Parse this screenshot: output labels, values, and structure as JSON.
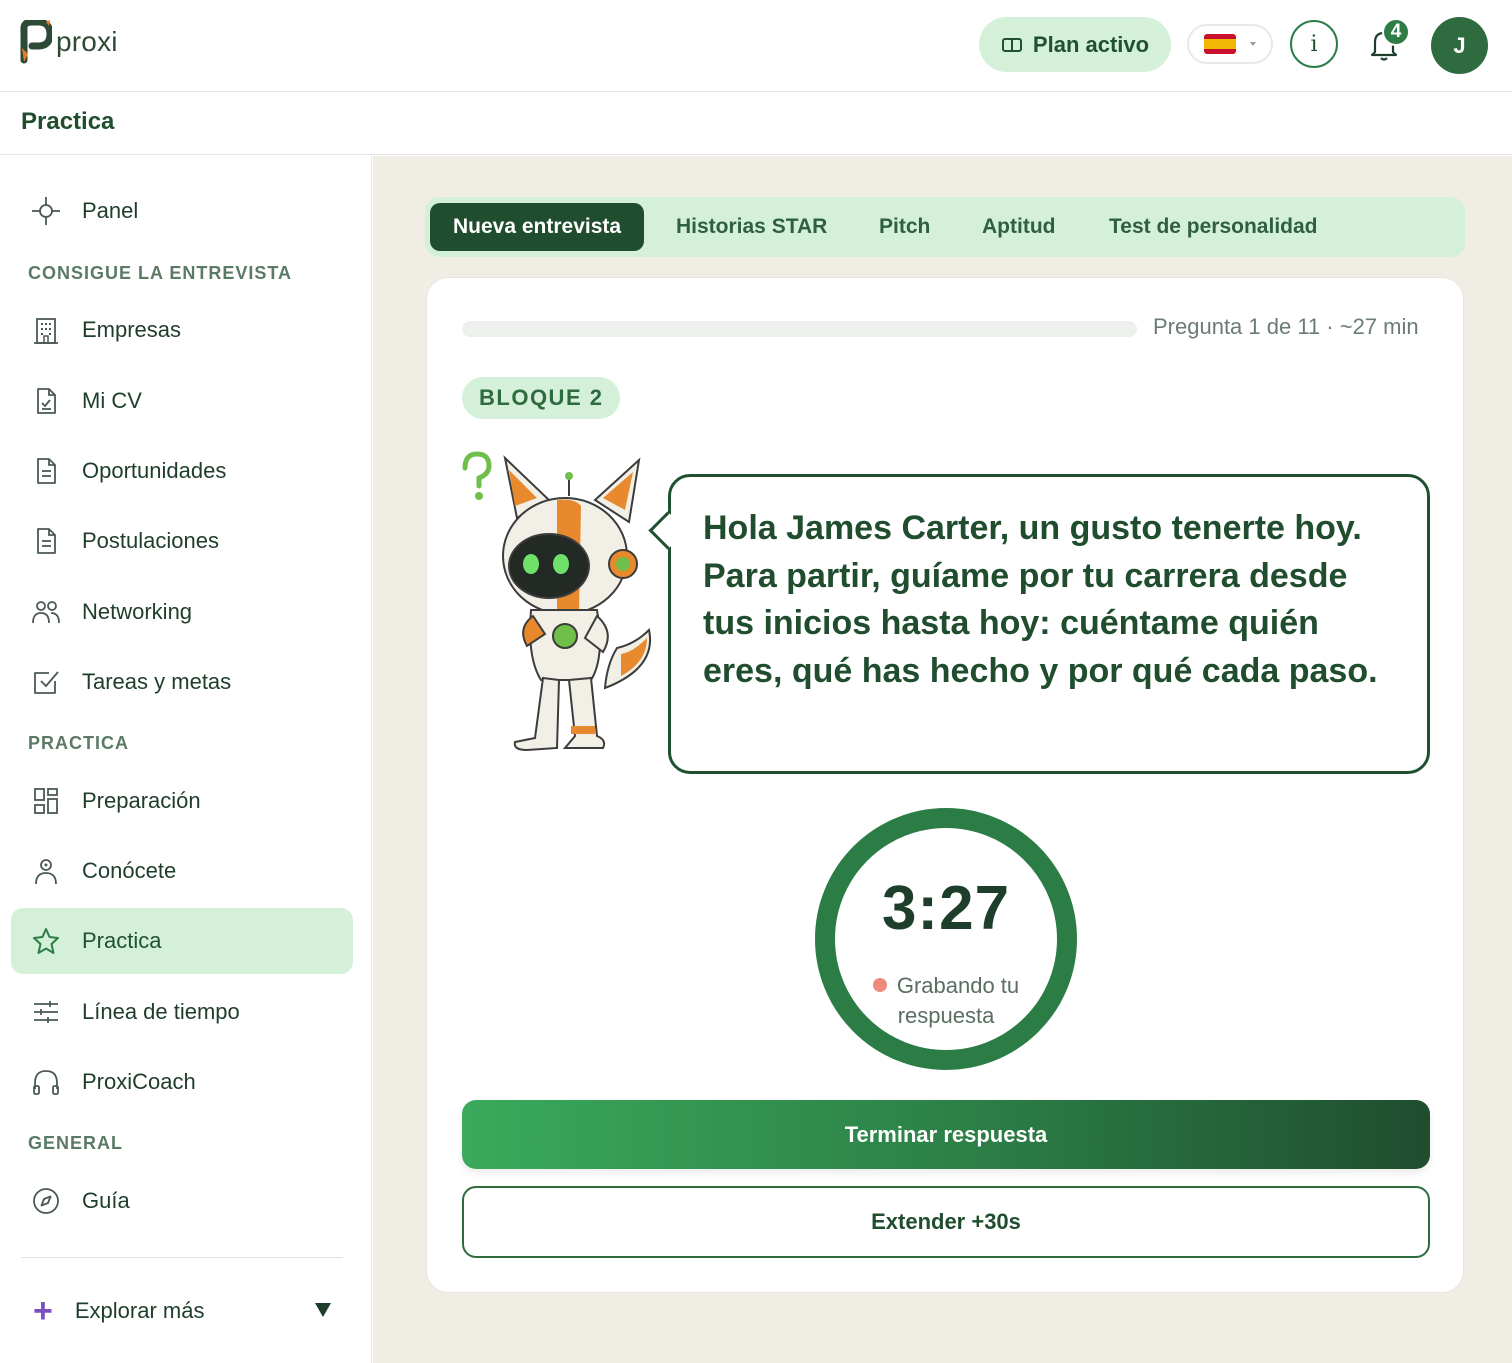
{
  "app": {
    "name": "proxi"
  },
  "header": {
    "plan_label": "Plan activo",
    "notification_count": "4",
    "avatar_initial": "J"
  },
  "page": {
    "title": "Practica"
  },
  "sidebar": {
    "panel": "Panel",
    "section1": "CONSIGUE LA ENTREVISTA",
    "items1": [
      {
        "label": "Empresas",
        "icon": "building-icon"
      },
      {
        "label": "Mi CV",
        "icon": "document-check-icon"
      },
      {
        "label": "Oportunidades",
        "icon": "document-icon"
      },
      {
        "label": "Postulaciones",
        "icon": "document-icon"
      },
      {
        "label": "Networking",
        "icon": "users-icon"
      },
      {
        "label": "Tareas y metas",
        "icon": "checkbox-icon"
      }
    ],
    "section2": "PRACTICA",
    "items2": [
      {
        "label": "Preparación",
        "icon": "grid-icon"
      },
      {
        "label": "Conócete",
        "icon": "user-icon"
      },
      {
        "label": "Practica",
        "icon": "star-icon",
        "active": true
      },
      {
        "label": "Línea de tiempo",
        "icon": "sliders-icon"
      },
      {
        "label": "ProxiCoach",
        "icon": "headphones-icon"
      }
    ],
    "section3": "GENERAL",
    "items3": [
      {
        "label": "Guía",
        "icon": "compass-icon"
      }
    ],
    "explore": "Explorar más"
  },
  "tabs": [
    {
      "label": "Nueva entrevista",
      "active": true
    },
    {
      "label": "Historias STAR"
    },
    {
      "label": "Pitch"
    },
    {
      "label": "Aptitud"
    },
    {
      "label": "Test de personalidad"
    }
  ],
  "question": {
    "progress_text": "Pregunta 1 de 11 · ~27 min",
    "progress_fraction": 0.0,
    "block": "BLOQUE 2",
    "text": "Hola James Carter, un gusto tenerte hoy. Para partir, guíame por tu carrera desde tus inicios hasta hoy: cuéntame quién eres, qué has hecho y por qué cada paso."
  },
  "timer": {
    "value": "3:27",
    "status": "Grabando tu respuesta",
    "remaining_fraction": 1.0
  },
  "actions": {
    "finish": "Terminar respuesta",
    "extend": "Extender +30s"
  },
  "colors": {
    "primary": "#2e7d46",
    "dark": "#1f4d2e",
    "light": "#d5f0d9",
    "background": "#f0ede5"
  }
}
